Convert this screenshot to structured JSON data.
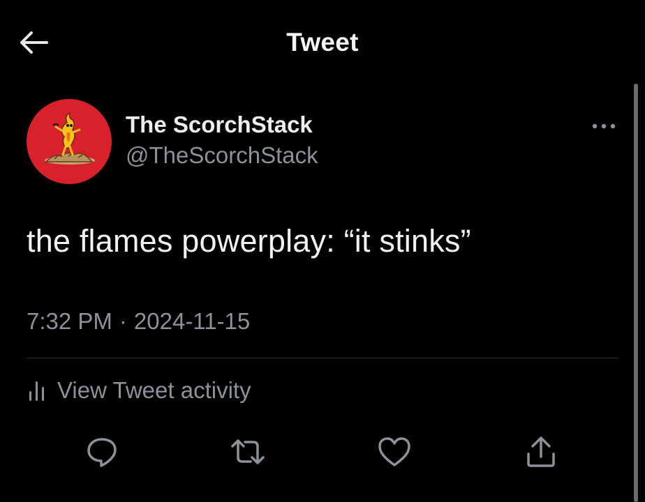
{
  "header": {
    "title": "Tweet",
    "back_icon": "arrow-left-icon"
  },
  "author": {
    "display_name": "The ScorchStack",
    "handle": "@TheScorchStack",
    "avatar_color": "#d8212b",
    "more_icon": "ellipsis-icon"
  },
  "tweet": {
    "text": "the flames powerplay: “it stinks”",
    "time": "7:32 PM",
    "separator": "·",
    "date": "2024-11-15"
  },
  "activity": {
    "label": "View Tweet activity",
    "icon": "bar-chart-icon"
  },
  "actions": [
    {
      "name": "reply",
      "icon": "reply-icon"
    },
    {
      "name": "retweet",
      "icon": "retweet-icon"
    },
    {
      "name": "like",
      "icon": "heart-icon"
    },
    {
      "name": "share",
      "icon": "share-icon"
    }
  ],
  "colors": {
    "background": "#000000",
    "primary_text": "#e7e9ea",
    "secondary_text": "#8b9299",
    "divider": "#2f3336"
  }
}
